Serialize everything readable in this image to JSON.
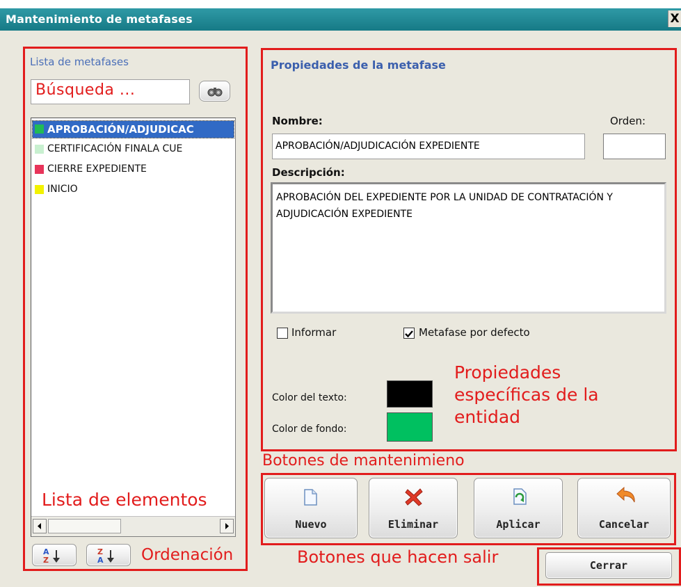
{
  "window": {
    "title": "Mantenimiento de metafases",
    "close": "X"
  },
  "left": {
    "list_title": "Lista de metafases",
    "search_value": "Búsqueda ...",
    "items": [
      {
        "label": "APROBACIÓN/ADJUDICAC",
        "color": "#22bb55",
        "selected": true
      },
      {
        "label": "CERTIFICACIÓN FINALA CUE",
        "color": "#c8f0d0",
        "selected": false
      },
      {
        "label": "CIERRE EXPEDIENTE",
        "color": "#e8345a",
        "selected": false
      },
      {
        "label": "INICIO",
        "color": "#f2f200",
        "selected": false
      }
    ],
    "sort_asc_label": "A Z",
    "sort_desc_label": "Z A"
  },
  "props": {
    "title": "Propiedades de la metafase",
    "name_label": "Nombre:",
    "name_value": "APROBACIÓN/ADJUDICACIÓN EXPEDIENTE",
    "order_label": "Orden:",
    "order_value": "",
    "desc_label": "Descripción:",
    "desc_value": "APROBACIÓN DEL EXPEDIENTE POR LA UNIDAD DE CONTRATACIÓN Y ADJUDICACIÓN EXPEDIENTE",
    "informar_label": "Informar",
    "informar_checked": false,
    "default_label": "Metafase por defecto",
    "default_checked": true,
    "text_color_label": "Color del texto:",
    "text_color": "#000000",
    "bg_color_label": "Color de fondo:",
    "bg_color": "#00c060"
  },
  "buttons": {
    "nuevo": "Nuevo",
    "eliminar": "Eliminar",
    "aplicar": "Aplicar",
    "cancelar": "Cancelar",
    "cerrar": "Cerrar"
  },
  "annotations": {
    "properties": "Propiedades\nespecíficas de la\nentidad",
    "maintenance": "Botones de mantenimieno",
    "list": "Lista de elementos",
    "sort": "Ordenación",
    "exit": "Botones que hacen salir"
  },
  "colors": {
    "accent_red": "#e21c1c",
    "title_blue": "#3b5fad",
    "selection": "#316ac5"
  }
}
